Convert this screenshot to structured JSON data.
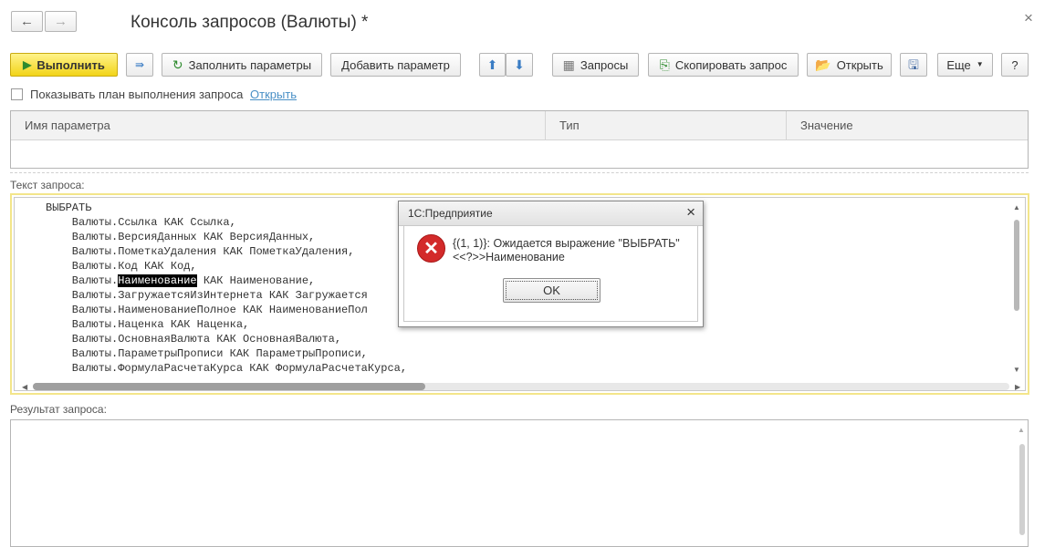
{
  "window": {
    "title": "Консоль запросов (Валюты) *",
    "close_glyph": "×"
  },
  "nav": {
    "back_glyph": "←",
    "forward_glyph": "→"
  },
  "toolbar": {
    "run_label": "Выполнить",
    "fill_params_label": "Заполнить параметры",
    "add_param_label": "Добавить параметр",
    "queries_label": "Запросы",
    "copy_query_label": "Скопировать запрос",
    "open_label": "Открыть",
    "more_label": "Еще",
    "help_label": "?"
  },
  "options": {
    "show_plan_label": "Показывать план выполнения запроса",
    "open_link": "Открыть"
  },
  "params_table": {
    "columns": [
      "Имя параметра",
      "Тип",
      "Значение"
    ]
  },
  "query": {
    "label": "Текст запроса:",
    "lines": [
      "ВЫБРАТЬ",
      "    Валюты.Ссылка КАК Ссылка,",
      "    Валюты.ВерсияДанных КАК ВерсияДанных,",
      "    Валюты.ПометкаУдаления КАК ПометкаУдаления,",
      "    Валюты.Код КАК Код,",
      "    Валюты.",
      "    Валюты.ЗагружаетсяИзИнтернета КАК Загружается",
      "    Валюты.НаименованиеПолное КАК НаименованиеПол",
      "    Валюты.Наценка КАК Наценка,",
      "    Валюты.ОсновнаяВалюта КАК ОсновнаяВалюта,",
      "    Валюты.ПараметрыПрописи КАК ПараметрыПрописи,",
      "    Валюты.ФормулаРасчетаКурса КАК ФормулаРасчетаКурса,"
    ],
    "highlighted_word": "Наименование",
    "line5_rest": " КАК Наименование,"
  },
  "result": {
    "label": "Результат запроса:"
  },
  "dialog": {
    "title": "1С:Предприятие",
    "message_line1": "{(1, 1)}: Ожидается выражение \"ВЫБРАТЬ\"",
    "message_line2": "<<?>>Наименование",
    "ok_label": "OK",
    "close_glyph": "×"
  },
  "colors": {
    "primary_button": "#f2d419",
    "error_icon": "#d32a2a",
    "link": "#4a90c6",
    "editor_focus_border": "#f3e58a"
  }
}
